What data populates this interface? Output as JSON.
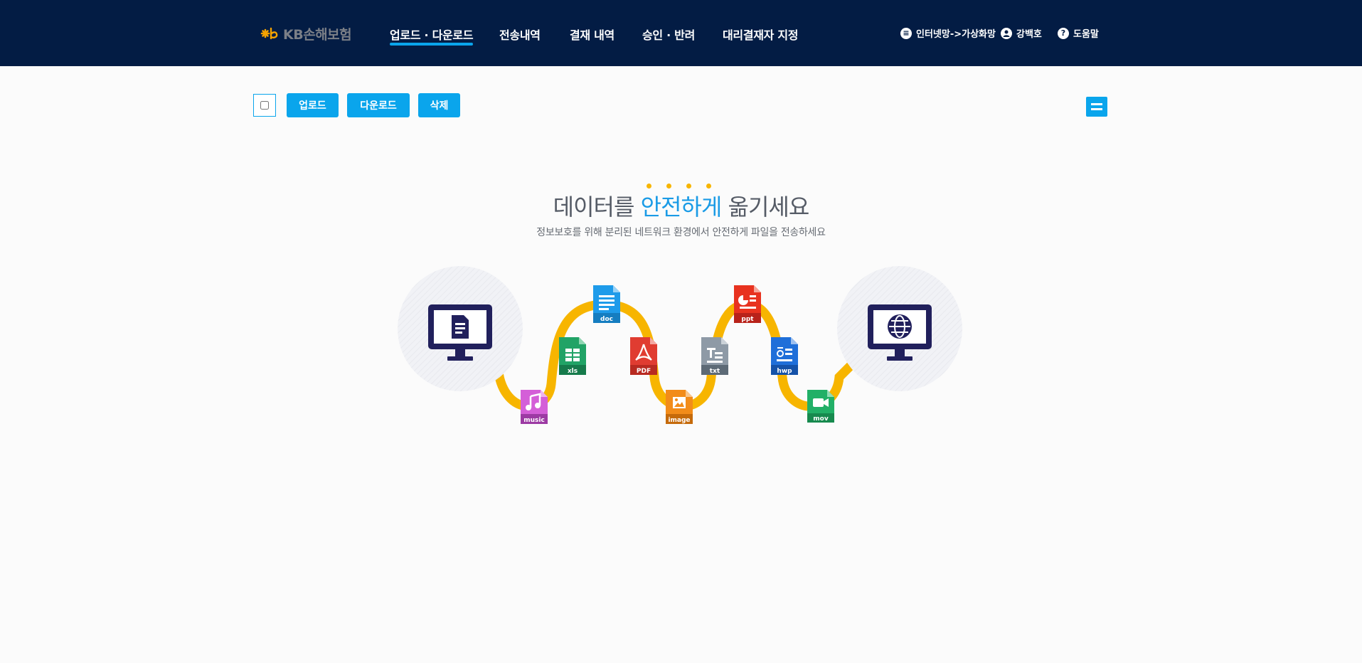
{
  "brand": {
    "logo_text": "KB손해보험"
  },
  "nav": {
    "items": [
      {
        "label": "업로드 · 다운로드",
        "active": true
      },
      {
        "label": "전송내역"
      },
      {
        "label": "결재 내역"
      },
      {
        "label": "승인 · 반려"
      },
      {
        "label": "대리결재자 지정"
      }
    ]
  },
  "utility": {
    "network": "인터넷망->가상화망",
    "user": "강백호",
    "help": "도움말"
  },
  "toolbar": {
    "upload_label": "업로드",
    "download_label": "다운로드",
    "delete_label": "삭제"
  },
  "hero": {
    "title_pre": "데이터를 ",
    "title_highlight": "안전하게",
    "title_post": " 옮기세요",
    "subtitle": "정보보호를 위해 분리된 네트워크 환경에서 안전하게 파일을 전송하세요"
  },
  "file_types": {
    "music": "music",
    "xls": "xls",
    "doc": "doc",
    "pdf": "PDF",
    "image": "image",
    "txt": "txt",
    "ppt": "ppt",
    "hwp": "hwp",
    "mov": "mov"
  },
  "colors": {
    "header_bg": "#031c44",
    "accent": "#0aa5ec",
    "path": "#f7b500",
    "monitor": "#21205c"
  }
}
